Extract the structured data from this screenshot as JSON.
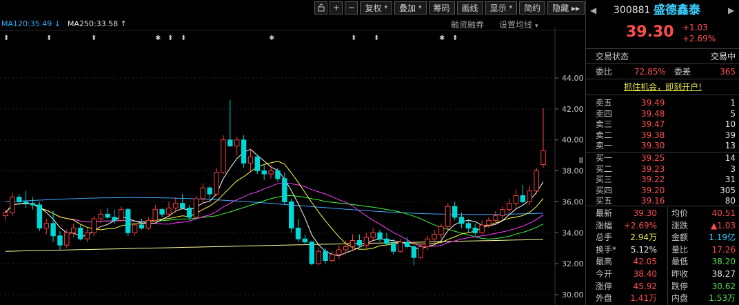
{
  "toolbar": {
    "buttons": [
      {
        "name": "lock-button",
        "label": "🔓"
      },
      {
        "name": "zoom-in-button",
        "label": "+"
      },
      {
        "name": "zoom-out-button",
        "label": "−"
      },
      {
        "name": "adjust-button",
        "label": "复权",
        "dropdown": true
      },
      {
        "name": "overlay-button",
        "label": "叠加",
        "dropdown": true
      },
      {
        "name": "chips-button",
        "label": "筹码"
      },
      {
        "name": "draw-button",
        "label": "画线"
      },
      {
        "name": "display-button",
        "label": "显示",
        "dropdown": true
      },
      {
        "name": "simple-button",
        "label": "简约"
      },
      {
        "name": "hide-button",
        "label": "隐藏 ▸▸"
      }
    ]
  },
  "ma_legend": {
    "ma120": "MA120:35.49",
    "ma120_arrow": "↓",
    "ma250": "MA250:33.58",
    "ma250_arrow": "↑"
  },
  "chart_links": {
    "margin": "融资融券",
    "ma_settings": "设置均线"
  },
  "stock": {
    "code": "300881",
    "name": "盛德鑫泰",
    "price": "39.30",
    "change": "+1.03",
    "change_pct": "+2.69%"
  },
  "trade_state": {
    "label": "交易状态",
    "value": "交易中"
  },
  "ratio": {
    "wb_label": "委比",
    "wb_value": "72.85%",
    "wc_label": "委差",
    "wc_value": "365"
  },
  "promo": "抓住机会，即刻开户!",
  "asks": [
    {
      "label": "卖五",
      "price": "39.49",
      "vol": "1"
    },
    {
      "label": "卖四",
      "price": "39.48",
      "vol": "5"
    },
    {
      "label": "卖三",
      "price": "39.47",
      "vol": "10"
    },
    {
      "label": "卖二",
      "price": "39.38",
      "vol": "39"
    },
    {
      "label": "卖一",
      "price": "39.30",
      "vol": "13"
    }
  ],
  "bids": [
    {
      "label": "买一",
      "price": "39.25",
      "vol": "14"
    },
    {
      "label": "买二",
      "price": "39.23",
      "vol": "3"
    },
    {
      "label": "买三",
      "price": "39.22",
      "vol": "31"
    },
    {
      "label": "买四",
      "price": "39.20",
      "vol": "305"
    },
    {
      "label": "买五",
      "price": "39.16",
      "vol": "80"
    }
  ],
  "stats": [
    {
      "l1": "最新",
      "v1": "39.30",
      "c1": "red",
      "l2": "均价",
      "v2": "40.51",
      "c2": "red"
    },
    {
      "l1": "涨幅",
      "v1": "+2.69%",
      "c1": "red",
      "l2": "涨跌",
      "v2": "▲1.03",
      "c2": "red"
    },
    {
      "l1": "总手",
      "v1": "2.94万",
      "c1": "yellow",
      "l2": "金额",
      "v2": "1.19亿",
      "c2": "cyan"
    },
    {
      "l1": "换手*",
      "v1": "5.12%",
      "c1": "white",
      "l2": "量比",
      "v2": "17.26",
      "c2": "red"
    },
    {
      "l1": "最高",
      "v1": "42.05",
      "c1": "red",
      "l2": "最低",
      "v2": "38.20",
      "c2": "green"
    },
    {
      "l1": "今开",
      "v1": "38.40",
      "c1": "red",
      "l2": "昨收",
      "v2": "38.27",
      "c2": "white"
    },
    {
      "l1": "涨停",
      "v1": "45.92",
      "c1": "red",
      "l2": "跌停",
      "v2": "30.62",
      "c2": "green"
    },
    {
      "l1": "外盘",
      "v1": "1.41万",
      "c1": "red",
      "l2": "内盘",
      "v2": "1.53万",
      "c2": "green"
    }
  ],
  "chart_data": {
    "type": "candlestick",
    "y_ticks": [
      "44.00",
      "42.00",
      "40.00",
      "38.00",
      "36.00",
      "34.00",
      "32.00",
      "30.00"
    ],
    "ylim": [
      30,
      44
    ],
    "ma120": 35.49,
    "ma250": 33.58,
    "colors": {
      "up": "#ff4040",
      "down": "#00d8d8",
      "ma5": "#ffffff",
      "ma10": "#ffff40",
      "ma20": "#ff40ff",
      "ma60": "#40ff40",
      "ma120": "#40a8ff",
      "ma250": "#ffffa0",
      "grid": "#2a2a2a"
    },
    "candles": [
      [
        35.1,
        35.5,
        34.8,
        35.3
      ],
      [
        35.3,
        36.6,
        35.1,
        36.3
      ],
      [
        36.3,
        36.5,
        35.8,
        36.0
      ],
      [
        36.0,
        36.7,
        35.6,
        35.9
      ],
      [
        35.9,
        36.3,
        35.5,
        35.8
      ],
      [
        35.8,
        36.0,
        34.1,
        34.3
      ],
      [
        34.3,
        34.9,
        33.9,
        34.6
      ],
      [
        34.6,
        35.4,
        33.4,
        33.8
      ],
      [
        33.8,
        34.1,
        32.9,
        33.2
      ],
      [
        33.2,
        34.2,
        33.0,
        34.0
      ],
      [
        34.0,
        34.6,
        33.7,
        34.3
      ],
      [
        34.3,
        34.5,
        33.5,
        33.6
      ],
      [
        33.6,
        34.3,
        33.4,
        34.0
      ],
      [
        34.0,
        35.1,
        33.8,
        34.9
      ],
      [
        34.9,
        35.5,
        34.6,
        35.2
      ],
      [
        35.2,
        35.6,
        34.9,
        35.0
      ],
      [
        35.0,
        35.5,
        34.6,
        34.8
      ],
      [
        34.8,
        35.7,
        34.7,
        35.5
      ],
      [
        35.5,
        35.6,
        33.8,
        34.0
      ],
      [
        34.0,
        34.6,
        33.8,
        34.5
      ],
      [
        34.5,
        34.9,
        34.2,
        34.3
      ],
      [
        34.3,
        35.0,
        34.2,
        34.8
      ],
      [
        34.8,
        35.8,
        34.6,
        35.5
      ],
      [
        35.5,
        35.6,
        35.0,
        35.2
      ],
      [
        35.2,
        36.0,
        35.0,
        35.6
      ],
      [
        35.6,
        36.3,
        35.3,
        35.9
      ],
      [
        35.9,
        36.5,
        35.5,
        35.6
      ],
      [
        35.6,
        35.8,
        34.8,
        35.0
      ],
      [
        35.0,
        36.4,
        34.9,
        36.2
      ],
      [
        36.2,
        37.2,
        35.9,
        36.9
      ],
      [
        36.9,
        37.0,
        36.2,
        36.5
      ],
      [
        36.5,
        38.2,
        36.4,
        37.9
      ],
      [
        37.9,
        40.3,
        37.8,
        40.0
      ],
      [
        40.0,
        42.6,
        39.6,
        39.6
      ],
      [
        39.6,
        40.2,
        39.0,
        40.0
      ],
      [
        40.0,
        40.3,
        38.2,
        38.5
      ],
      [
        38.5,
        39.4,
        38.0,
        38.9
      ],
      [
        38.9,
        39.0,
        37.8,
        38.0
      ],
      [
        38.0,
        38.4,
        37.4,
        37.8
      ],
      [
        37.8,
        38.4,
        37.5,
        38.0
      ],
      [
        38.0,
        38.2,
        37.3,
        37.5
      ],
      [
        37.5,
        37.9,
        35.8,
        36.0
      ],
      [
        36.0,
        36.2,
        34.0,
        34.3
      ],
      [
        34.3,
        34.9,
        33.4,
        33.6
      ],
      [
        33.6,
        33.9,
        33.2,
        33.4
      ],
      [
        33.4,
        33.5,
        31.9,
        32.0
      ],
      [
        32.0,
        33.0,
        31.9,
        32.8
      ],
      [
        32.8,
        33.0,
        32.0,
        32.2
      ],
      [
        32.2,
        32.8,
        32.1,
        32.6
      ],
      [
        32.6,
        33.2,
        32.3,
        32.9
      ],
      [
        32.9,
        33.5,
        32.6,
        33.1
      ],
      [
        33.1,
        33.9,
        32.8,
        33.5
      ],
      [
        33.5,
        33.9,
        33.0,
        33.2
      ],
      [
        33.2,
        34.0,
        33.0,
        33.7
      ],
      [
        33.7,
        34.3,
        33.5,
        34.0
      ],
      [
        34.0,
        34.2,
        33.4,
        33.6
      ],
      [
        33.6,
        34.0,
        33.2,
        33.3
      ],
      [
        33.3,
        33.6,
        32.6,
        32.8
      ],
      [
        32.8,
        33.6,
        32.7,
        33.4
      ],
      [
        33.4,
        33.7,
        33.0,
        33.1
      ],
      [
        33.1,
        33.2,
        31.9,
        32.4
      ],
      [
        32.4,
        33.3,
        32.3,
        33.1
      ],
      [
        33.1,
        33.8,
        32.9,
        33.6
      ],
      [
        33.6,
        34.2,
        33.3,
        33.9
      ],
      [
        33.9,
        34.6,
        33.6,
        34.4
      ],
      [
        34.4,
        35.9,
        34.1,
        35.7
      ],
      [
        35.7,
        36.0,
        34.8,
        35.0
      ],
      [
        35.0,
        35.3,
        34.3,
        34.6
      ],
      [
        34.6,
        34.9,
        34.0,
        34.3
      ],
      [
        34.3,
        34.6,
        33.8,
        34.0
      ],
      [
        34.0,
        34.8,
        33.9,
        34.5
      ],
      [
        34.5,
        35.0,
        34.3,
        34.8
      ],
      [
        34.8,
        35.4,
        34.6,
        35.1
      ],
      [
        35.1,
        35.7,
        34.9,
        35.5
      ],
      [
        35.5,
        36.2,
        35.3,
        35.9
      ],
      [
        35.9,
        36.8,
        35.6,
        36.4
      ],
      [
        36.4,
        37.1,
        35.9,
        36.0
      ],
      [
        36.0,
        37.0,
        35.8,
        36.7
      ],
      [
        36.7,
        38.2,
        36.5,
        38.0
      ],
      [
        38.4,
        42.05,
        38.2,
        39.3
      ]
    ]
  }
}
